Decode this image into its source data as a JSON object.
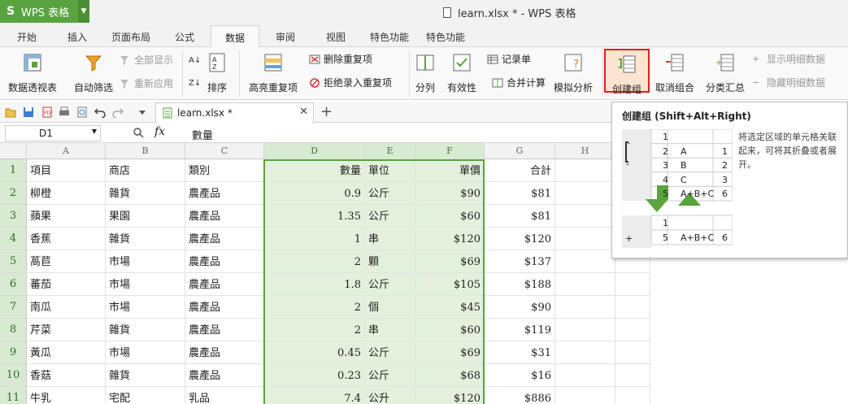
{
  "app": {
    "name": "WPS 表格",
    "window_title": "learn.xlsx * - WPS 表格"
  },
  "tabs": [
    "开始",
    "插入",
    "页面布局",
    "公式",
    "数据",
    "审阅",
    "视图",
    "特色功能",
    "特色功能"
  ],
  "ribbon": {
    "pivot": "数据透视表",
    "autofilter": "自动筛选",
    "show_all": "全部显示",
    "reapply": "重新应用",
    "sort": "排序",
    "highlight_dup": "高亮重复项",
    "remove_dup": "删除重复项",
    "reject_dup": "拒绝录入重复项",
    "split": "分列",
    "validity": "有效性",
    "record": "记录单",
    "consolidate": "合并计算",
    "whatif": "模拟分析",
    "group": "创建组",
    "ungroup": "取消组合",
    "subtotal": "分类汇总",
    "show_detail": "显示明细数据",
    "hide_detail": "隐藏明细数据"
  },
  "doc_tab": "learn.xlsx *",
  "formula": {
    "cell_ref": "D1",
    "fx": "fx",
    "value": "數量"
  },
  "columns": [
    "A",
    "B",
    "C",
    "D",
    "E",
    "F",
    "G",
    "H"
  ],
  "row_numbers": [
    "1",
    "2",
    "3",
    "4",
    "5",
    "6",
    "7",
    "8",
    "9",
    "10",
    "11"
  ],
  "rows": [
    [
      "項目",
      "商店",
      "類別",
      "數量",
      "單位",
      "單價",
      "合計"
    ],
    [
      "柳橙",
      "雜貨",
      "農產品",
      "0.9",
      "公斤",
      "$90",
      "$81"
    ],
    [
      "蘋果",
      "果園",
      "農產品",
      "1.35",
      "公斤",
      "$60",
      "$81"
    ],
    [
      "香蕉",
      "雜貨",
      "農產品",
      "1",
      "串",
      "$120",
      "$120"
    ],
    [
      "萵苣",
      "市場",
      "農產品",
      "2",
      "顆",
      "$69",
      "$137"
    ],
    [
      "蕃茄",
      "市場",
      "農產品",
      "1.8",
      "公斤",
      "$105",
      "$188"
    ],
    [
      "南瓜",
      "市場",
      "農產品",
      "2",
      "個",
      "$45",
      "$90"
    ],
    [
      "芹菜",
      "雜貨",
      "農產品",
      "2",
      "串",
      "$60",
      "$119"
    ],
    [
      "黃瓜",
      "市場",
      "農產品",
      "0.45",
      "公斤",
      "$69",
      "$31"
    ],
    [
      "香菇",
      "雜貨",
      "農產品",
      "0.23",
      "公斤",
      "$68",
      "$16"
    ],
    [
      "牛乳",
      "宅配",
      "乳品",
      "7.4",
      "公升",
      "$120",
      "$886"
    ]
  ],
  "tooltip": {
    "title": "创建组 (Shift+Alt+Right)",
    "description": "将选定区域的单元格关联起来，可将其折叠或者展开。",
    "example_rows": [
      [
        "1",
        "",
        ""
      ],
      [
        "2",
        "A",
        "1"
      ],
      [
        "3",
        "B",
        "2"
      ],
      [
        "4",
        "C",
        "3"
      ],
      [
        "5",
        "A+B+C",
        "6"
      ]
    ],
    "collapsed_rows": [
      [
        "1",
        "",
        ""
      ],
      [
        "5",
        "A+B+C",
        "6"
      ]
    ],
    "expand_symbol": "-",
    "collapse_symbol": "+"
  },
  "colors": {
    "brand": "#58a33f",
    "selection": "#5aa33f",
    "highlight": "#e3f1dc"
  }
}
